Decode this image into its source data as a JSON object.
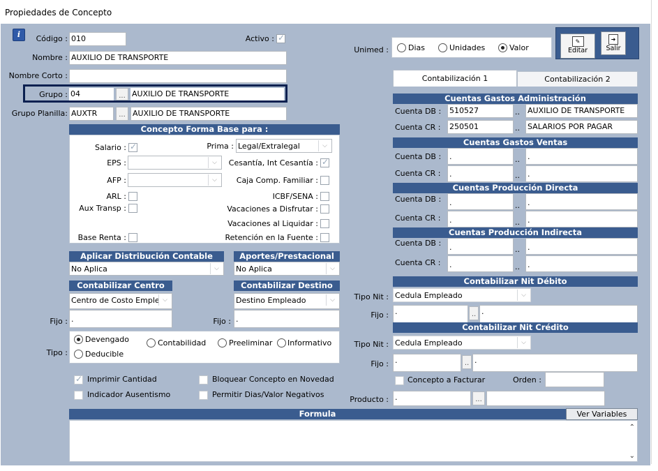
{
  "window": {
    "title": "Propiedades de Concepto"
  },
  "info_icon": "info-icon",
  "codigo": {
    "label": "Código :",
    "value": "010"
  },
  "activo": {
    "label": "Activo :",
    "checked": true
  },
  "nombre": {
    "label": "Nombre :",
    "value": "AUXILIO DE TRANSPORTE"
  },
  "nombre_corto": {
    "label": "Nombre Corto :",
    "value": ""
  },
  "grupo": {
    "label": "Grupo :",
    "code": "04",
    "dots": "...",
    "name": "AUXILIO DE TRANSPORTE"
  },
  "grupo_planilla": {
    "label": "Grupo Planilla:",
    "code": "AUXTR",
    "dots": "...",
    "name": "AUXILIO DE TRANSPORTE"
  },
  "base_section": {
    "title": "Concepto Forma Base para :",
    "salario": {
      "label": "Salario :",
      "checked": true
    },
    "prima": {
      "label": "Prima :",
      "value": "Legal/Extralegal"
    },
    "eps": {
      "label": "EPS :",
      "value": ""
    },
    "cesantia": {
      "label": "Cesantía, Int Cesantía :",
      "checked": true
    },
    "afp": {
      "label": "AFP :",
      "value": ""
    },
    "caja": {
      "label": "Caja Comp. Familiar :",
      "checked": false
    },
    "arl": {
      "label": "ARL :",
      "checked": false
    },
    "icbf": {
      "label": "ICBF/SENA :",
      "checked": false
    },
    "aux_transp": {
      "label": "Aux Transp :",
      "checked": false
    },
    "vac_disfrutar": {
      "label": "Vacaciones a Disfrutar :",
      "checked": false
    },
    "vac_liquidar": {
      "label": "Vacaciones al Liquidar :",
      "checked": false
    },
    "base_renta": {
      "label": "Base Renta :",
      "checked": false
    },
    "retencion": {
      "label": "Retención en la Fuente :",
      "checked": false
    }
  },
  "aplicar_dist": {
    "title": "Aplicar Distribución Contable",
    "value": "No Aplica"
  },
  "aportes": {
    "title": "Aportes/Prestacional",
    "value": "No Aplica"
  },
  "cont_centro": {
    "title": "Contabilizar Centro",
    "value": "Centro de Costo Emple",
    "fijo_label": "Fijo :",
    "fijo_value": "."
  },
  "cont_destino": {
    "title": "Contabilizar Destino",
    "value": "Destino Empleado",
    "fijo_label": "Fijo :",
    "fijo_value": "."
  },
  "tipo": {
    "label": "Tipo :",
    "options": [
      "Devengado",
      "Contabilidad",
      "Preeliminar",
      "Informativo",
      "Deducible"
    ],
    "selected": "Devengado"
  },
  "checks": {
    "imprimir": {
      "label": "Imprimir Cantidad",
      "checked": true
    },
    "bloquear": {
      "label": "Bloquear Concepto en Novedad",
      "checked": false
    },
    "ausentismo": {
      "label": "Indicador Ausentismo",
      "checked": false
    },
    "permitir": {
      "label": "Permitir Dias/Valor Negativos",
      "checked": false
    }
  },
  "formula": {
    "title": "Formula",
    "ver_variables": "Ver Variables",
    "value": ""
  },
  "unimed": {
    "label": "Unimed :",
    "options": [
      "Dias",
      "Unidades",
      "Valor"
    ],
    "selected": "Valor"
  },
  "toolbar": {
    "editar": "Editar",
    "salir": "Salir"
  },
  "tabs": [
    "Contabilización 1",
    "Contabilización 2"
  ],
  "accounts": {
    "admin": {
      "title": "Cuentas Gastos Administración",
      "db_label": "Cuenta DB :",
      "db_code": "510527",
      "db_name": "AUXILIO DE TRANSPORTE",
      "cr_label": "Cuenta CR :",
      "cr_code": "250501",
      "cr_name": "SALARIOS POR PAGAR"
    },
    "ventas": {
      "title": "Cuentas Gastos Ventas",
      "db_label": "Cuenta DB :",
      "db_code": ".",
      "db_name": ".",
      "cr_label": "Cuenta CR :",
      "cr_code": ".",
      "cr_name": "."
    },
    "prod_directa": {
      "title": "Cuentas Producción Directa",
      "db_label": "Cuenta DB :",
      "db_code": ".",
      "db_name": ".",
      "cr_label": "Cuenta CR :",
      "cr_code": ".",
      "cr_name": "."
    },
    "prod_indirecta": {
      "title": "Cuentas Producción Indirecta",
      "db_label": "Cuenta DB :",
      "db_code": ".",
      "db_name": ".",
      "cr_label": "Cuenta CR :",
      "cr_code": ".",
      "cr_name": "."
    },
    "dots": ".."
  },
  "nit_debito": {
    "title": "Contabilizar Nit Débito",
    "tipo_label": "Tipo Nit :",
    "tipo_value": "Cedula Empleado",
    "fijo_label": "Fijo :",
    "fijo_code": ".",
    "fijo_dots": "..",
    "fijo_name": "."
  },
  "nit_credito": {
    "title": "Contabilizar Nit Crédito",
    "tipo_label": "Tipo Nit :",
    "tipo_value": "Cedula Empleado",
    "fijo_label": "Fijo :",
    "fijo_code": ".",
    "fijo_dots": "..",
    "fijo_name": "."
  },
  "facturar": {
    "label": "Concepto a Facturar",
    "checked": false
  },
  "orden": {
    "label": "Orden :",
    "value": ""
  },
  "producto": {
    "label": "Producto :",
    "code": ".",
    "dots": "...",
    "name": ""
  },
  "colors": {
    "client_bg": "#abb9cd",
    "header_bg": "#3a5c8f",
    "highlight_border": "#0b2050"
  }
}
